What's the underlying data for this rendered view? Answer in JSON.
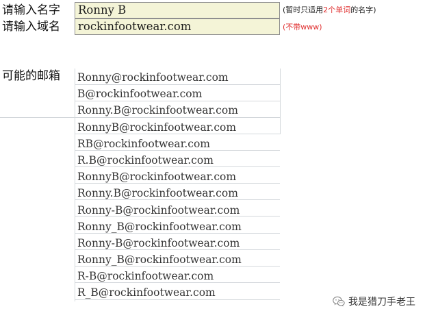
{
  "inputs": {
    "name_label": "请输入名字",
    "name_value": "Ronny B",
    "name_note_prefix": "(暂时只适用",
    "name_note_highlight": "2个单词",
    "name_note_suffix": "的名字)",
    "domain_label": "请输入域名",
    "domain_value": "rockinfootwear.com",
    "domain_note": "(不带www)"
  },
  "results": {
    "label": "可能的邮箱",
    "emails": [
      "Ronny@rockinfootwear.com",
      "B@rockinfootwear.com",
      "Ronny.B@rockinfootwear.com",
      "RonnyB@rockinfootwear.com",
      "RB@rockinfootwear.com",
      "R.B@rockinfootwear.com",
      "RonnyB@rockinfootwear.com",
      "Ronny.B@rockinfootwear.com",
      "Ronny-B@rockinfootwear.com",
      "Ronny_B@rockinfootwear.com",
      "Ronny-B@rockinfootwear.com",
      "Ronny_B@rockinfootwear.com",
      "R-B@rockinfootwear.com",
      "R_B@rockinfootwear.com"
    ]
  },
  "watermark": {
    "icon": "wechat-icon",
    "text": "我是猎刀手老王"
  },
  "colors": {
    "input_bg": "#f4f4d7",
    "note_red": "#e03030",
    "grid_line": "#d3d7db"
  }
}
